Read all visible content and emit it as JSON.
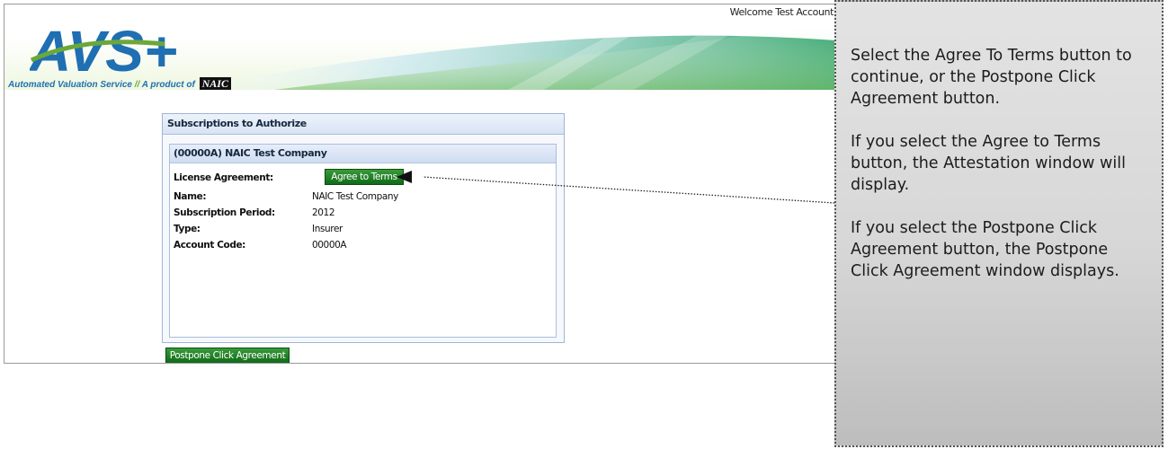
{
  "header": {
    "welcome_text": "Welcome Test Account",
    "logo_text": "AVS+",
    "tagline_service": "Automated Valuation Service",
    "tagline_sep": "//",
    "tagline_product": "A product of",
    "tagline_brand": "NAIC"
  },
  "subscriptions_panel": {
    "title": "Subscriptions to Authorize",
    "company": {
      "title": "(00000A) NAIC Test Company",
      "fields": [
        {
          "label": "License Agreement:",
          "button": "Agree to Terms"
        },
        {
          "label": "Name:",
          "value": "NAIC Test Company"
        },
        {
          "label": "Subscription Period:",
          "value": "2012"
        },
        {
          "label": "Type:",
          "value": "Insurer"
        },
        {
          "label": "Account Code:",
          "value": "00000A"
        }
      ]
    },
    "postpone_button": "Postpone Click Agreement"
  },
  "callout": {
    "paragraphs": [
      "Select the Agree To Terms button to continue, or the Postpone Click Agreement button.",
      "If you select the Agree to Terms button, the Attestation window will display.",
      "If you select the Postpone Click Agreement button, the Postpone Click Agreement window displays."
    ]
  },
  "colors": {
    "button_green": "#0f6a18",
    "panel_blue": "#d7e3f4",
    "logo_blue": "#1f6fb2",
    "logo_green": "#6aa83a"
  }
}
